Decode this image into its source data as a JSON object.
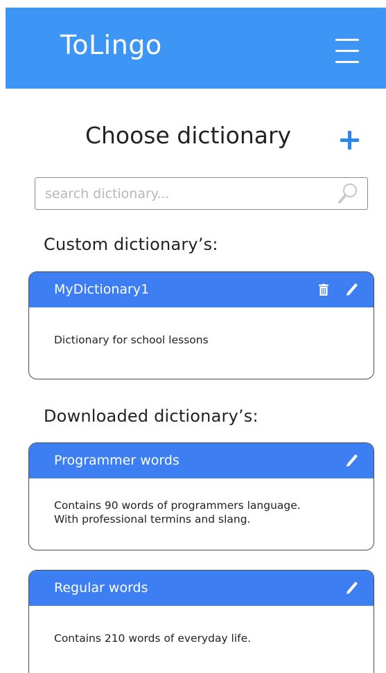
{
  "header": {
    "app_title": "ToLingo",
    "menu_icon": "hamburger-menu-icon"
  },
  "page": {
    "title": "Choose dictionary",
    "add_icon": "plus-icon"
  },
  "search": {
    "placeholder": "search dictionary...",
    "value": "",
    "icon": "search-icon"
  },
  "custom_section": {
    "heading": "Custom dictionary’s:",
    "items": [
      {
        "title": "MyDictionary1",
        "description": "Dictionary for school lessons",
        "actions": [
          "trash-icon",
          "pencil-icon"
        ]
      }
    ]
  },
  "downloaded_section": {
    "heading": "Downloaded dictionary’s:",
    "items": [
      {
        "title": "Programmer words",
        "description_line1": "Contains 90 words of programmers language.",
        "description_line2": "With professional termins and slang.",
        "actions": [
          "pencil-icon"
        ]
      },
      {
        "title": "Regular words",
        "description": "Contains 210 words of everyday life.",
        "actions": [
          "pencil-icon"
        ]
      }
    ]
  },
  "colors": {
    "header_bg": "#3d95f5",
    "card_header_bg": "#3d7ef3",
    "accent": "#2d86ea",
    "text": "#222222"
  }
}
